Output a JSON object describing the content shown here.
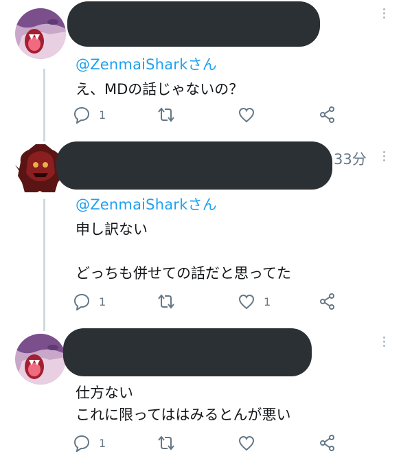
{
  "colors": {
    "link": "#1da1f2",
    "text": "#14171a",
    "secondary": "#657786",
    "thread_line": "#cfd9de",
    "redaction": "#2b3035"
  },
  "tweets": [
    {
      "mention": "@ZenmaiSharkさん",
      "lines": [
        "え、MDの話じゃないの？"
      ],
      "reply_count": "1",
      "retweet_count": "",
      "like_count": ""
    },
    {
      "time": "33分",
      "mention": "@ZenmaiSharkさん",
      "lines": [
        "申し訳ない",
        "",
        "どっちも併せての話だと思ってた"
      ],
      "reply_count": "1",
      "retweet_count": "",
      "like_count": "1"
    },
    {
      "lines": [
        "仕方ない",
        "これに限ってははみるとんが悪い"
      ],
      "reply_count": "1",
      "retweet_count": "",
      "like_count": ""
    }
  ],
  "icons": [
    "reply-icon",
    "retweet-icon",
    "like-icon",
    "share-icon",
    "more-icon"
  ]
}
